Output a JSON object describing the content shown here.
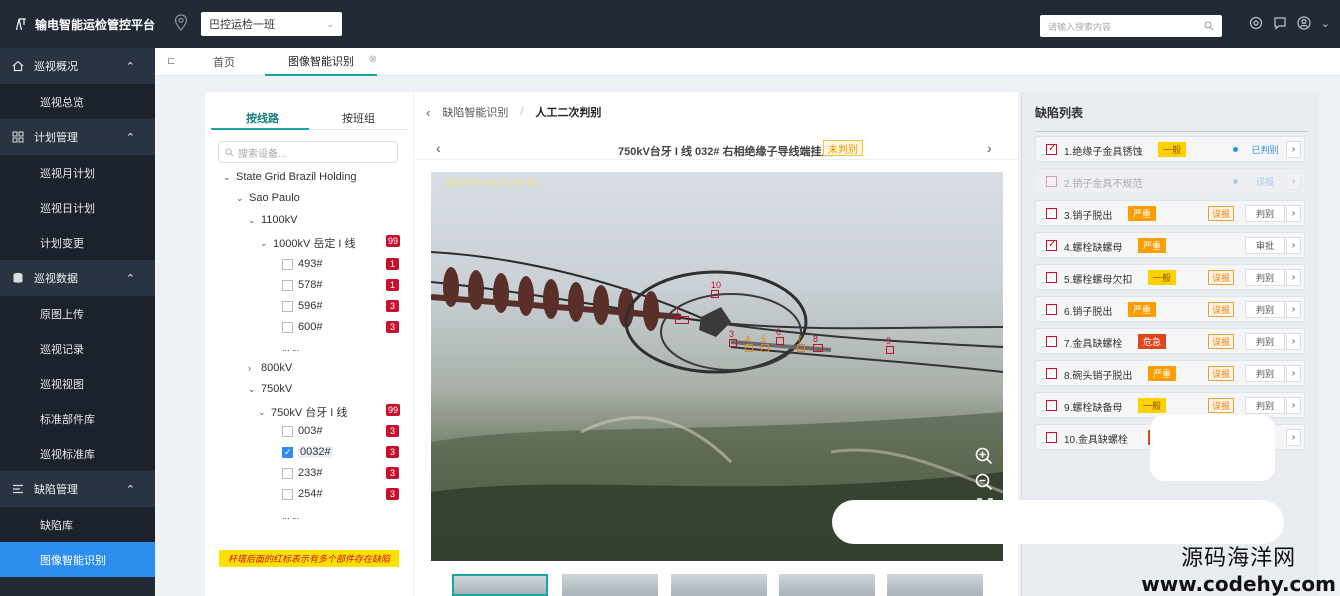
{
  "app": {
    "title": "输电智能运检管控平台"
  },
  "header": {
    "team": "巴控运检一班",
    "search_placeholder": "请输入搜索内容",
    "icons": [
      "location-icon",
      "search-icon",
      "settings-icon",
      "message-icon",
      "user-icon",
      "more-icon"
    ]
  },
  "sidebar": {
    "groups": [
      {
        "label": "巡视概况",
        "items": [
          "巡视总览"
        ]
      },
      {
        "label": "计划管理",
        "items": [
          "巡视月计划",
          "巡视日计划",
          "计划变更"
        ]
      },
      {
        "label": "巡视数据",
        "items": [
          "原图上传",
          "巡视记录",
          "巡视视图",
          "标准部件库",
          "巡视标准库"
        ]
      },
      {
        "label": "缺陷管理",
        "items": [
          "缺陷库",
          "图像智能识别"
        ]
      }
    ],
    "active_item": "图像智能识别"
  },
  "tabs": {
    "home": "首页",
    "current": "图像智能识别"
  },
  "tree": {
    "tabs": [
      "按线路",
      "按班组"
    ],
    "search_placeholder": "搜索设备...",
    "org": "State Grid Brazil Holding",
    "region": "Sao Paulo",
    "v1100": "1100kV",
    "line1": "1000kV 岳定 I 线",
    "line1_badge": "99",
    "line1_towers": [
      {
        "name": "493#",
        "count": "1",
        "checked": false
      },
      {
        "name": "578#",
        "count": "1",
        "checked": false
      },
      {
        "name": "596#",
        "count": "3",
        "checked": false
      },
      {
        "name": "600#",
        "count": "3",
        "checked": false
      }
    ],
    "ellipsis": "... ...",
    "v800": "800kV",
    "v750": "750kV",
    "line2": "750kV 台牙 I 线",
    "line2_badge": "99",
    "line2_towers": [
      {
        "name": "003#",
        "count": "3",
        "checked": false
      },
      {
        "name": "0032#",
        "count": "3",
        "checked": true
      },
      {
        "name": "233#",
        "count": "3",
        "checked": false
      },
      {
        "name": "254#",
        "count": "3",
        "checked": false
      }
    ],
    "hint": "杆塔后面的红标表示有多个部件存在缺陷"
  },
  "center": {
    "breadcrumb": [
      "缺陷智能识别",
      "人工二次判别"
    ],
    "image_title": "750kV台牙 I 线 032# 右相绝缘子导线端挂点",
    "status": "未判别",
    "timestamp": "2022-05-04  15:30:25",
    "marker_labels": [
      "1",
      "2",
      "3",
      "4",
      "5",
      "6",
      "7",
      "8",
      "9",
      "10"
    ]
  },
  "defects": {
    "title": "缺陷列表",
    "items": [
      {
        "name": "1.绝缘子金具锈蚀",
        "severity": "一般",
        "level": "normal",
        "checked": true,
        "misreport": "",
        "action": "已判别",
        "done": true,
        "faded": false
      },
      {
        "name": "2.销子金具不规范",
        "severity": "",
        "level": "",
        "checked": false,
        "misreport": "",
        "action": "误报",
        "done": true,
        "faded": true
      },
      {
        "name": "3.销子脱出",
        "severity": "严重",
        "level": "serious",
        "checked": false,
        "misreport": "误报",
        "action": "判别",
        "done": false,
        "faded": false
      },
      {
        "name": "4.螺栓缺螺母",
        "severity": "严重",
        "level": "serious",
        "checked": true,
        "misreport": "",
        "action": "审批",
        "done": false,
        "faded": false
      },
      {
        "name": "5.螺栓螺母欠扣",
        "severity": "一般",
        "level": "normal",
        "checked": false,
        "misreport": "误报",
        "action": "判别",
        "done": false,
        "faded": false
      },
      {
        "name": "6.销子脱出",
        "severity": "严重",
        "level": "serious",
        "checked": false,
        "misreport": "误报",
        "action": "判别",
        "done": false,
        "faded": false
      },
      {
        "name": "7.金具缺螺栓",
        "severity": "危急",
        "level": "urgent",
        "checked": false,
        "misreport": "误报",
        "action": "判别",
        "done": false,
        "faded": false
      },
      {
        "name": "8.碗头销子脱出",
        "severity": "严重",
        "level": "serious",
        "checked": false,
        "misreport": "误报",
        "action": "判别",
        "done": false,
        "faded": false
      },
      {
        "name": "9.螺栓缺备母",
        "severity": "一般",
        "level": "normal",
        "checked": false,
        "misreport": "误报",
        "action": "判别",
        "done": false,
        "faded": false
      },
      {
        "name": "10.金具缺螺栓",
        "severity": "",
        "level": "urgent",
        "checked": false,
        "misreport": "",
        "action": "",
        "done": false,
        "faded": false
      }
    ]
  },
  "watermark": {
    "line1": "源码海洋网",
    "line2": "www.codehy.com"
  },
  "colors": {
    "accent": "#19a7a5",
    "sidebar": "#222a36",
    "active": "#2e8ef0",
    "danger": "#c8102e"
  }
}
